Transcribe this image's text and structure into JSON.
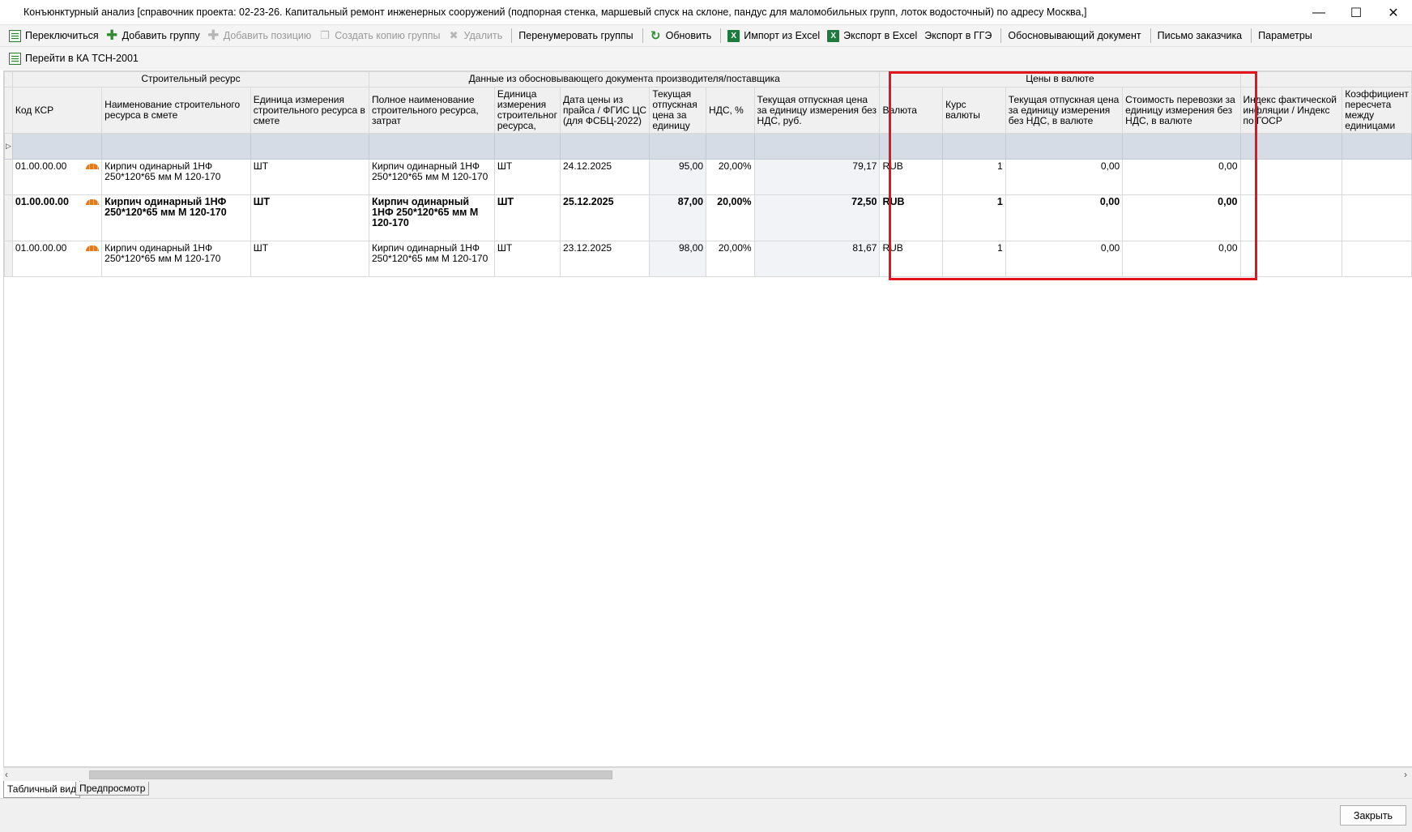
{
  "window": {
    "title": "Конъюнктурный анализ [справочник проекта: 02-23-26. Капитальный ремонт инженерных сооружений (подпорная стенка, маршевый спуск на склоне, пандус для маломобильных групп, лоток водосточный) по адресу Москва,]",
    "minimize": "—",
    "maximize": "☐",
    "close": "✕"
  },
  "toolbar1": {
    "switch": "Переключиться",
    "add_group": "Добавить группу",
    "add_position": "Добавить позицию",
    "copy_group": "Создать копию группы",
    "delete": "Удалить",
    "renumber": "Перенумеровать группы",
    "refresh": "Обновить",
    "import_excel": "Импорт из Excel",
    "export_excel": "Экспорт в Excel",
    "export_gge": "Экспорт в ГГЭ",
    "justifying_doc": "Обосновывающий документ",
    "customer_letter": "Письмо заказчика",
    "parameters": "Параметры"
  },
  "toolbar2": {
    "goto_ka": "Перейти в КА ТСН-2001"
  },
  "grid": {
    "groups": {
      "resource": "Строительный ресурс",
      "supplier_data": "Данные из обосновывающего документа производителя/поставщика",
      "currency_prices": "Цены в валюте"
    },
    "columns": [
      "Код КСР",
      "Наименование строительного ресурса в смете",
      "Единица измерения строительного ресурса в смете",
      "Полное наименование строительного ресурса, затрат",
      "Единица измерения строительног ресурса,",
      "Дата цены из прайса / ФГИС ЦС (для ФСБЦ-2022)",
      "Текущая отпускная цена за единицу",
      "НДС, %",
      "Текущая отпускная цена за единицу измерения без НДС, руб.",
      "Валюта",
      "Курс валюты",
      "Текущая отпускная цена за единицу измерения без НДС, в валюте",
      "Стоимость перевозки за единицу измерения без НДС, в валюте",
      "Индекс фактической инфляции / Индекс по ГОСР",
      "Коэффициент пересчета между единицами"
    ],
    "filter_row_marker": "▷",
    "rows": [
      {
        "code": "01.00.00.00",
        "name": "Кирпич одинарный 1НФ 250*120*65 мм М 120-170",
        "unit": "ШТ",
        "full_name": "Кирпич одинарный 1НФ 250*120*65 мм М 120-170",
        "unit2": "ШТ",
        "date": "24.12.2025",
        "price": "95,00",
        "vat": "20,00%",
        "price_no_vat": "79,17",
        "currency": "RUB",
        "rate": "1",
        "price_cur": "0,00",
        "transport_cur": "0,00",
        "bold": false
      },
      {
        "code": "01.00.00.00",
        "name": "Кирпич одинарный 1НФ 250*120*65 мм М 120-170",
        "unit": "ШТ",
        "full_name": "Кирпич одинарный 1НФ 250*120*65 мм М 120-170",
        "unit2": "ШТ",
        "date": "25.12.2025",
        "price": "87,00",
        "vat": "20,00%",
        "price_no_vat": "72,50",
        "currency": "RUB",
        "rate": "1",
        "price_cur": "0,00",
        "transport_cur": "0,00",
        "bold": true
      },
      {
        "code": "01.00.00.00",
        "name": "Кирпич одинарный 1НФ 250*120*65 мм М 120-170",
        "unit": "ШТ",
        "full_name": "Кирпич одинарный 1НФ 250*120*65 мм М 120-170",
        "unit2": "ШТ",
        "date": "23.12.2025",
        "price": "98,00",
        "vat": "20,00%",
        "price_no_vat": "81,67",
        "currency": "RUB",
        "rate": "1",
        "price_cur": "0,00",
        "transport_cur": "0,00",
        "bold": false
      }
    ]
  },
  "tabs": {
    "table_view": "Табличный вид",
    "preview": "Предпросмотр"
  },
  "footer": {
    "close": "Закрыть"
  },
  "colors": {
    "highlight": "#e5141c",
    "filter_row": "#d6dce6",
    "excel_green": "#1f7a3d"
  }
}
